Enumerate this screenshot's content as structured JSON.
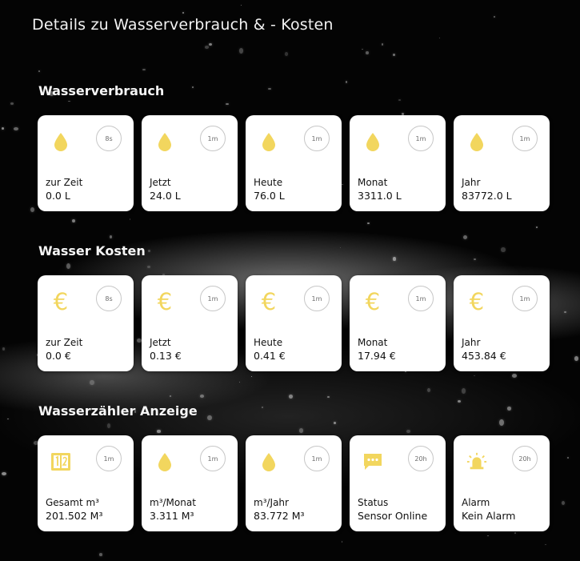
{
  "header": {
    "title": "Details zu Wasserverbrauch & - Kosten"
  },
  "colors": {
    "icon_accent": "#f2d65e",
    "card_bg": "#ffffff"
  },
  "sections": [
    {
      "title": "Wasserverbrauch",
      "cards": [
        {
          "icon": "water-drop-icon",
          "badge": "8s",
          "label": "zur Zeit",
          "value": "0.0 L"
        },
        {
          "icon": "water-drop-icon",
          "badge": "1m",
          "label": "Jetzt",
          "value": "24.0 L"
        },
        {
          "icon": "water-drop-icon",
          "badge": "1m",
          "label": "Heute",
          "value": "76.0 L"
        },
        {
          "icon": "water-drop-icon",
          "badge": "1m",
          "label": "Monat",
          "value": "3311.0 L"
        },
        {
          "icon": "water-drop-icon",
          "badge": "1m",
          "label": "Jahr",
          "value": "83772.0 L"
        }
      ]
    },
    {
      "title": "Wasser Kosten",
      "cards": [
        {
          "icon": "euro-icon",
          "badge": "8s",
          "label": "zur Zeit",
          "value": "0.0 €"
        },
        {
          "icon": "euro-icon",
          "badge": "1m",
          "label": "Jetzt",
          "value": "0.13 €"
        },
        {
          "icon": "euro-icon",
          "badge": "1m",
          "label": "Heute",
          "value": "0.41 €"
        },
        {
          "icon": "euro-icon",
          "badge": "1m",
          "label": "Monat",
          "value": "17.94 €"
        },
        {
          "icon": "euro-icon",
          "badge": "1m",
          "label": "Jahr",
          "value": "453.84 €"
        }
      ]
    },
    {
      "title": "Wasserzähler Anzeige",
      "cards": [
        {
          "icon": "meter-counter-icon",
          "badge": "1m",
          "label": "Gesamt m³",
          "value": "201.502 M³"
        },
        {
          "icon": "water-drop-icon",
          "badge": "1m",
          "label": "m³/Monat",
          "value": "3.311 M³"
        },
        {
          "icon": "water-drop-icon",
          "badge": "1m",
          "label": "m³/Jahr",
          "value": "83.772 M³"
        },
        {
          "icon": "message-icon",
          "badge": "20h",
          "label": "Status",
          "value": "Sensor Online"
        },
        {
          "icon": "alarm-siren-icon",
          "badge": "20h",
          "label": "Alarm",
          "value": "Kein Alarm"
        }
      ]
    }
  ]
}
